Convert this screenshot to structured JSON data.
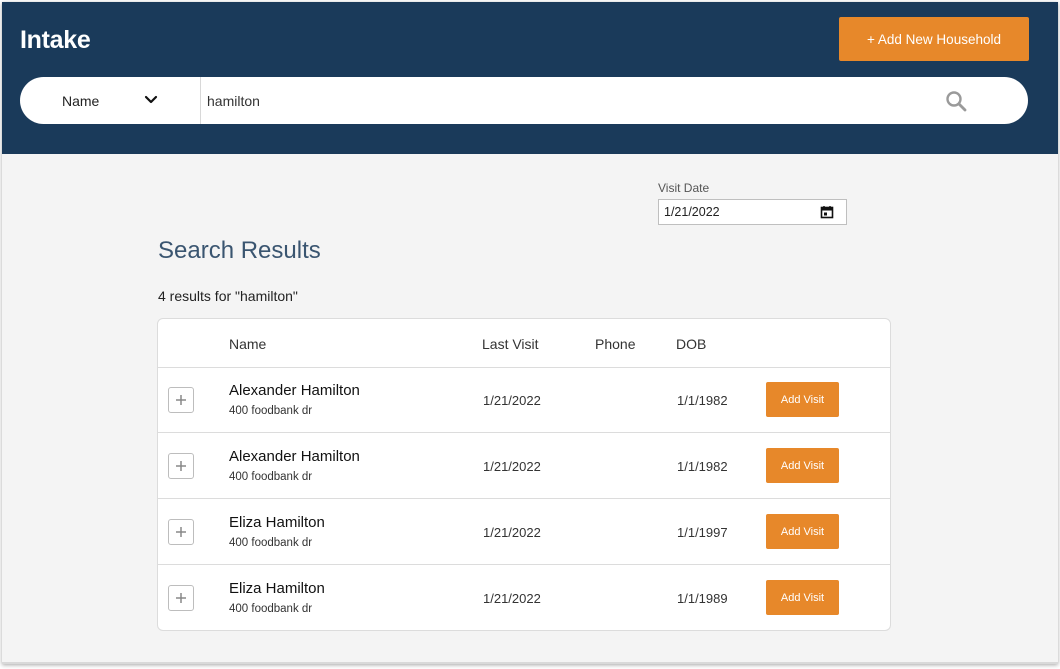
{
  "header": {
    "title": "Intake",
    "add_household_label": "+ Add New Household"
  },
  "search": {
    "type_label": "Name",
    "query": "hamilton",
    "search_icon": "search-icon"
  },
  "visit_date": {
    "label": "Visit Date",
    "value": "1/21/2022"
  },
  "results": {
    "heading": "Search Results",
    "count_text": "4 results for \"hamilton\"",
    "columns": {
      "name": "Name",
      "last_visit": "Last Visit",
      "phone": "Phone",
      "dob": "DOB"
    },
    "rows": [
      {
        "name": "Alexander Hamilton",
        "address": "400 foodbank dr",
        "last_visit": "1/21/2022",
        "phone": "",
        "dob": "1/1/1982",
        "action": "Add Visit"
      },
      {
        "name": "Alexander Hamilton",
        "address": "400 foodbank dr",
        "last_visit": "1/21/2022",
        "phone": "",
        "dob": "1/1/1982",
        "action": "Add Visit"
      },
      {
        "name": "Eliza Hamilton",
        "address": "400 foodbank dr",
        "last_visit": "1/21/2022",
        "phone": "",
        "dob": "1/1/1997",
        "action": "Add Visit"
      },
      {
        "name": "Eliza Hamilton",
        "address": "400 foodbank dr",
        "last_visit": "1/21/2022",
        "phone": "",
        "dob": "1/1/1989",
        "action": "Add Visit"
      }
    ]
  },
  "colors": {
    "header_bg": "#1a3a5a",
    "accent": "#e7882a",
    "heading_text": "#3a5570"
  }
}
